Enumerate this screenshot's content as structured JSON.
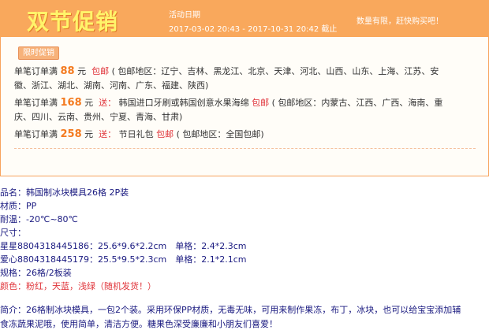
{
  "promo": {
    "title": "双节促销",
    "date_label": "活动日期",
    "date_range": "2017-03-02 20:43 - 2017-10-31 20:42 截止",
    "slogan": "数量有限，赶快购买吧！",
    "badge": "限时促销",
    "rules": [
      {
        "prefix": "单笔订单满",
        "amount": "88",
        "unit": "元",
        "action": "包邮",
        "detail_line1": "( 包邮地区：辽宁、吉林、黑龙江、北京、天津、河北、山西、山东、上海、江苏、安",
        "detail_line2": "徽、浙江、湖北、湖南、河南、广东、福建、陕西)"
      },
      {
        "prefix": "单笔订单满",
        "amount": "168",
        "unit": "元",
        "action": "送：",
        "gift": "韩国进口牙刷或韩国创意水果海绵",
        "action2": "包邮",
        "detail_line1": "( 包邮地区：内蒙古、江西、广西、海南、重",
        "detail_line2": "庆、四川、云南、贵州、宁夏、青海、甘肃)"
      },
      {
        "prefix": "单笔订单满",
        "amount": "258",
        "unit": "元",
        "action": "送：",
        "gift": "节日礼包",
        "action2": "包邮",
        "detail_line1": "( 包邮地区：全国包邮)"
      }
    ]
  },
  "specs": {
    "name": "品名：韩国制冰块模具26格 2P装",
    "material": "材质：PP",
    "temperature": "耐温：-20℃~80℃",
    "size_label": "尺寸：",
    "size_star": "星星8804318445186：25.6*9.6*2.2cm　单格：2.4*2.3cm",
    "size_heart": "爱心8804318445179：25.5*9.5*2.3cm　单格：2.1*2.1cm",
    "spec": "规格：26格/2板装",
    "colors": "颜色：粉红，天蓝，浅绿（随机发货！）",
    "intro_line1": "简介：26格制冰块模具，一包2个装。采用环保PP材质，无毒无味，可用来制作果冻，布丁，冰块，也可以给宝宝添加辅",
    "intro_line2": "食冻蔬果泥哦，使用简单，清洁方便。糖果色深受廉廉和小朋友们喜爱！"
  },
  "colors": {
    "header_bg": "#f9a85c",
    "title_color": "#fff46a",
    "amount_color": "#f47b20",
    "gift_color": "#e0353b",
    "spec_text": "#1a1a80"
  }
}
